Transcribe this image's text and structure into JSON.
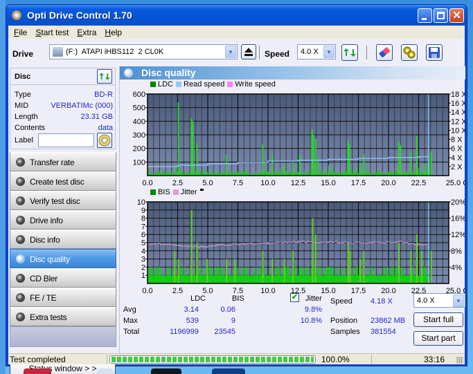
{
  "window": {
    "title": "Opti Drive Control 1.70",
    "controls": {
      "minimize": "minimize",
      "maximize": "maximize",
      "close": "✕"
    }
  },
  "menu": [
    "File",
    "Start test",
    "Extra",
    "Help"
  ],
  "toolbar": {
    "drive_label": "Drive",
    "drive_value": "(F:)  ATAPI iHBS112  2 CL0K",
    "speed_label": "Speed",
    "speed_value": "4.0 X",
    "icons": [
      "eject-icon",
      "refresh-drive-icon",
      "erase-icon",
      "settings-gears-icon",
      "save-icon"
    ]
  },
  "disc": {
    "heading": "Disc",
    "fields": [
      {
        "key": "Type",
        "value": "BD-R"
      },
      {
        "key": "MID",
        "value": "VERBATIMc (000)"
      },
      {
        "key": "Length",
        "value": "23.31 GB"
      },
      {
        "key": "Contents",
        "value": "data"
      }
    ],
    "label_key": "Label",
    "label_value": ""
  },
  "nav": [
    {
      "label": "Transfer rate",
      "active": false
    },
    {
      "label": "Create test disc",
      "active": false
    },
    {
      "label": "Verify test disc",
      "active": false
    },
    {
      "label": "Drive info",
      "active": false
    },
    {
      "label": "Disc info",
      "active": false
    },
    {
      "label": "Disc quality",
      "active": true
    },
    {
      "label": "CD Bler",
      "active": false
    },
    {
      "label": "FE / TE",
      "active": false
    },
    {
      "label": "Extra tests",
      "active": false
    }
  ],
  "status_window_button": "Status window > >",
  "panel": {
    "title": "Disc quality"
  },
  "colors": {
    "ldc": "#00a000",
    "bis": "#00a000",
    "bar_green": "#10d010",
    "read_speed": "#8cc8ff",
    "write_speed": "#ff80ff",
    "jitter": "#d8a0d8",
    "plot_bg_top": "#4a5a7c",
    "plot_bg_bottom": "#7c8cb0",
    "value_blue": "#2525c8"
  },
  "chart_data": [
    {
      "type": "bar",
      "title": "LDC / Read speed",
      "legend": [
        "LDC",
        "Read speed",
        "Write speed"
      ],
      "legend_position": "top-left",
      "xlabel": "GB",
      "xlim": [
        0,
        25
      ],
      "x_ticks": [
        "0.0",
        "2.5",
        "5.0",
        "7.5",
        "10.0",
        "12.5",
        "15.0",
        "17.5",
        "20.0",
        "22.5",
        "25.0 GB"
      ],
      "ylim": [
        0,
        600
      ],
      "y_ticks": [
        "100",
        "200",
        "300",
        "400",
        "500",
        "600"
      ],
      "y2lim": [
        0,
        18
      ],
      "y2_ticks": [
        "2 X",
        "4 X",
        "6 X",
        "8 X",
        "10 X",
        "12 X",
        "14 X",
        "16 X",
        "18 X"
      ],
      "grid": true,
      "ldc_spikes": [
        {
          "x": 2.5,
          "y": 539
        },
        {
          "x": 3.6,
          "y": 420
        },
        {
          "x": 3.7,
          "y": 400
        },
        {
          "x": 4.05,
          "y": 240
        },
        {
          "x": 6.5,
          "y": 155
        },
        {
          "x": 9.5,
          "y": 230
        },
        {
          "x": 10.3,
          "y": 155
        },
        {
          "x": 11.3,
          "y": 85
        },
        {
          "x": 12.0,
          "y": 100
        },
        {
          "x": 12.6,
          "y": 155
        },
        {
          "x": 13.6,
          "y": 340
        },
        {
          "x": 13.7,
          "y": 300
        },
        {
          "x": 13.9,
          "y": 270
        },
        {
          "x": 14.1,
          "y": 125
        },
        {
          "x": 15.0,
          "y": 75
        },
        {
          "x": 16.6,
          "y": 260
        },
        {
          "x": 16.7,
          "y": 230
        },
        {
          "x": 17.6,
          "y": 95
        },
        {
          "x": 17.9,
          "y": 155
        },
        {
          "x": 20.8,
          "y": 250
        },
        {
          "x": 20.95,
          "y": 225
        },
        {
          "x": 21.8,
          "y": 180
        },
        {
          "x": 22.3,
          "y": 290
        },
        {
          "x": 22.9,
          "y": 90
        },
        {
          "x": 23.3,
          "y": 140
        },
        {
          "x": 23.5,
          "y": 180
        }
      ],
      "ldc_baseline_max": 40,
      "read_speed": [
        {
          "x": 0.0,
          "y": 2.0
        },
        {
          "x": 2.5,
          "y": 2.3
        },
        {
          "x": 5.0,
          "y": 2.6
        },
        {
          "x": 7.5,
          "y": 2.9
        },
        {
          "x": 10.0,
          "y": 3.2
        },
        {
          "x": 12.5,
          "y": 3.4
        },
        {
          "x": 15.0,
          "y": 3.6
        },
        {
          "x": 17.5,
          "y": 3.8
        },
        {
          "x": 20.0,
          "y": 4.0
        },
        {
          "x": 22.5,
          "y": 4.18
        },
        {
          "x": 23.3,
          "y": 4.18
        }
      ],
      "end_marker_x": 23.31
    },
    {
      "type": "bar",
      "title": "BIS / Jitter",
      "legend": [
        "BIS",
        "Jitter"
      ],
      "legend_position": "top-left",
      "xlabel": "GB",
      "xlim": [
        0,
        25
      ],
      "x_ticks": [
        "0.0",
        "2.5",
        "5.0",
        "7.5",
        "10.0",
        "12.5",
        "15.0",
        "17.5",
        "20.0",
        "22.5",
        "25.0 GB"
      ],
      "ylim": [
        0,
        10
      ],
      "y_ticks": [
        "1",
        "2",
        "3",
        "4",
        "5",
        "6",
        "7",
        "8",
        "9",
        "10"
      ],
      "y2lim": [
        0,
        20
      ],
      "y2_ticks": [
        "4%",
        "8%",
        "12%",
        "16%",
        "20%"
      ],
      "grid": true,
      "bis_spikes": [
        {
          "x": 2.2,
          "y": 4
        },
        {
          "x": 2.5,
          "y": 3
        },
        {
          "x": 3.6,
          "y": 9
        },
        {
          "x": 4.05,
          "y": 5
        },
        {
          "x": 4.9,
          "y": 3
        },
        {
          "x": 6.5,
          "y": 3
        },
        {
          "x": 7.2,
          "y": 3
        },
        {
          "x": 9.5,
          "y": 4
        },
        {
          "x": 10.3,
          "y": 3
        },
        {
          "x": 11.3,
          "y": 3
        },
        {
          "x": 12.0,
          "y": 4
        },
        {
          "x": 13.65,
          "y": 8
        },
        {
          "x": 13.9,
          "y": 6
        },
        {
          "x": 16.6,
          "y": 5
        },
        {
          "x": 16.75,
          "y": 4
        },
        {
          "x": 17.6,
          "y": 3
        },
        {
          "x": 17.9,
          "y": 4
        },
        {
          "x": 20.8,
          "y": 5
        },
        {
          "x": 21.8,
          "y": 4
        },
        {
          "x": 22.3,
          "y": 6
        },
        {
          "x": 22.7,
          "y": 4
        },
        {
          "x": 23.5,
          "y": 4
        }
      ],
      "bis_baseline_max": 2,
      "jitter_percent": [
        {
          "x": 0.0,
          "y": 9.8
        },
        {
          "x": 1.5,
          "y": 9.6
        },
        {
          "x": 3.0,
          "y": 9.1
        },
        {
          "x": 4.5,
          "y": 9.0
        },
        {
          "x": 6.0,
          "y": 9.4
        },
        {
          "x": 8.0,
          "y": 9.7
        },
        {
          "x": 10.0,
          "y": 9.9
        },
        {
          "x": 12.5,
          "y": 10.2
        },
        {
          "x": 15.0,
          "y": 10.1
        },
        {
          "x": 17.5,
          "y": 10.0
        },
        {
          "x": 20.0,
          "y": 10.1
        },
        {
          "x": 21.0,
          "y": 10.2
        },
        {
          "x": 21.8,
          "y": 9.6
        },
        {
          "x": 23.3,
          "y": 9.5
        }
      ],
      "end_marker_x": 23.31
    }
  ],
  "stats": {
    "col_ldc": "LDC",
    "col_bis": "BIS",
    "jitter_label": "Jitter",
    "jitter_checked": true,
    "rows": [
      {
        "label": "Avg",
        "ldc": "3.14",
        "bis": "0.06",
        "jitter": "9.8%"
      },
      {
        "label": "Max",
        "ldc": "539",
        "bis": "9",
        "jitter": "10.8%"
      },
      {
        "label": "Total",
        "ldc": "1196999",
        "bis": "23545",
        "jitter": ""
      }
    ],
    "speed_label": "Speed",
    "speed_value": "4.18 X",
    "speed_select": "4.0 X",
    "position_label": "Position",
    "position_value": "23862 MB",
    "samples_label": "Samples",
    "samples_value": "381554",
    "start_full": "Start full",
    "start_part": "Start part"
  },
  "statusbar": {
    "message": "Test completed",
    "progress_percent": 100,
    "progress_text": "100.0%",
    "elapsed": "33:16"
  }
}
